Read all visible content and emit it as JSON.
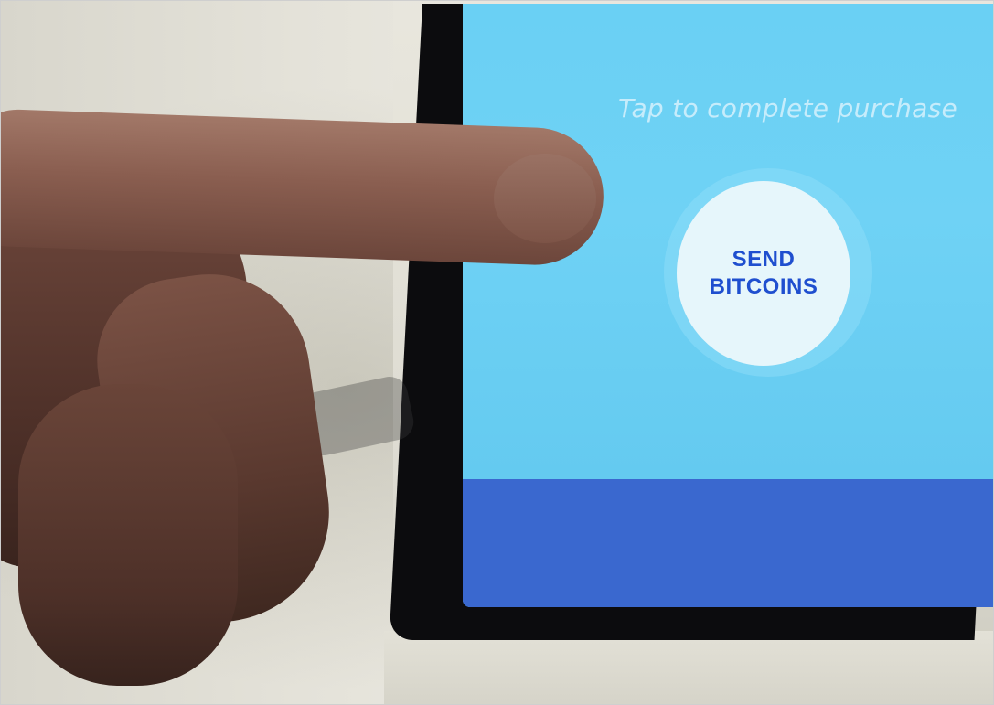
{
  "screen": {
    "prompt_text": "Tap to complete purchase",
    "button": {
      "line1": "SEND",
      "line2": "BITCOINS"
    }
  },
  "colors": {
    "screen_background": "#67cdf2",
    "button_fill": "#e6f6fb",
    "button_text": "#1f4fcf",
    "bottom_bar": "#3a68cf",
    "prompt_text": "#c6ecfb"
  },
  "scene": {
    "subject": "finger-icon"
  }
}
